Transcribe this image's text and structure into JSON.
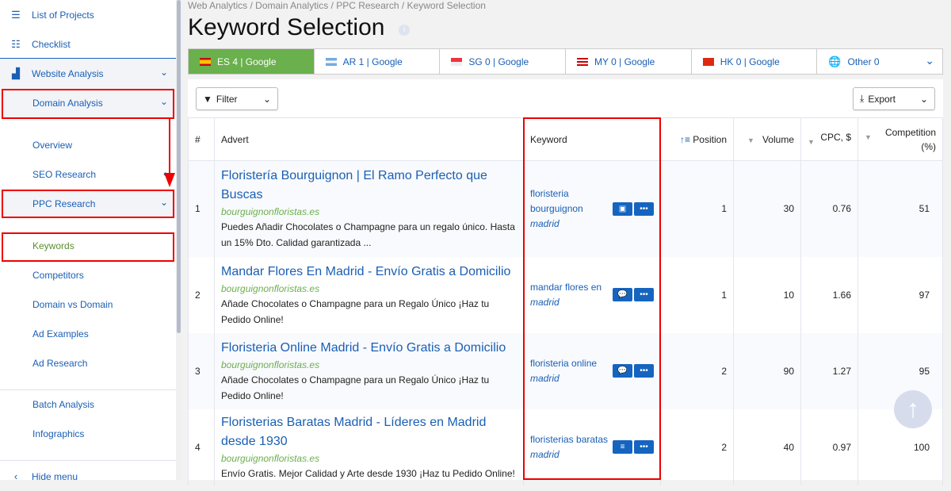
{
  "sidebar": {
    "top": [
      {
        "label": "List of Projects",
        "icon": "menu-icon"
      },
      {
        "label": "Checklist",
        "icon": "checklist-icon"
      }
    ],
    "website_analysis": "Website Analysis",
    "domain_analysis": "Domain Analysis",
    "overview": "Overview",
    "seo_research": "SEO Research",
    "ppc_research": "PPC Research",
    "ppc_items": [
      "Keywords",
      "Competitors",
      "Domain vs Domain",
      "Ad Examples",
      "Ad Research"
    ],
    "other_items": [
      "Batch Analysis",
      "Infographics"
    ],
    "hide_menu": "Hide menu"
  },
  "breadcrumb": "Web Analytics / Domain Analytics / PPC Research / Keyword Selection",
  "page_title": "Keyword Selection",
  "tabs": [
    {
      "label": "ES 4 | Google",
      "active": true,
      "flag": "spain"
    },
    {
      "label": "AR 1 | Google",
      "flag": "argentina"
    },
    {
      "label": "SG 0 | Google",
      "flag": "singapore"
    },
    {
      "label": "MY 0 | Google",
      "flag": "malaysia"
    },
    {
      "label": "HK 0 | Google",
      "flag": "hong-kong"
    },
    {
      "label": "Other 0",
      "flag": "globe"
    }
  ],
  "toolbar": {
    "filter": "Filter",
    "export": "Export"
  },
  "table": {
    "headers": [
      "#",
      "Advert",
      "Keyword",
      "Position",
      "Volume",
      "CPC, $",
      "Competition (%)"
    ],
    "rows": [
      {
        "n": "1",
        "title": "Floristería Bourguignon | El Ramo Perfecto que Buscas",
        "url": "bourguignonfloristas.es",
        "desc": "Puedes Añadir Chocolates o Champagne para un regalo único. Hasta un 15% Dto. Calidad garantizada ...",
        "kw": "floristeria bourguignon",
        "loc": "madrid",
        "icon": "contact-card-icon",
        "pos": "1",
        "vol": "30",
        "cpc": "0.76",
        "comp": "51"
      },
      {
        "n": "2",
        "title": "Mandar Flores En Madrid - Envío Gratis a Domicilio",
        "url": "bourguignonfloristas.es",
        "desc": "Añade Chocolates o Champagne para un Regalo Único ¡Haz tu Pedido Online!",
        "kw": "mandar flores en",
        "loc": "madrid",
        "icon": "comment-icon",
        "pos": "1",
        "vol": "10",
        "cpc": "1.66",
        "comp": "97"
      },
      {
        "n": "3",
        "title": "Floristeria Online Madrid - Envío Gratis a Domicilio",
        "url": "bourguignonfloristas.es",
        "desc": "Añade Chocolates o Champagne para un Regalo Único ¡Haz tu Pedido Online!",
        "kw": "floristeria online",
        "loc": "madrid",
        "icon": "comment-icon",
        "pos": "2",
        "vol": "90",
        "cpc": "1.27",
        "comp": "95"
      },
      {
        "n": "4",
        "title": "Floristerias Baratas Madrid - Líderes en Madrid desde 1930",
        "url": "bourguignonfloristas.es",
        "desc": "Envío Gratis. Mejor Calidad y Arte desde 1930 ¡Haz tu Pedido Online!",
        "kw": "floristerias baratas",
        "loc": "madrid",
        "icon": "list-icon",
        "pos": "2",
        "vol": "40",
        "cpc": "0.97",
        "comp": "100"
      }
    ]
  },
  "colors": {
    "accent": "#1a5fb4",
    "active_tab": "#6ab04c",
    "highlight": "#ee0000"
  }
}
